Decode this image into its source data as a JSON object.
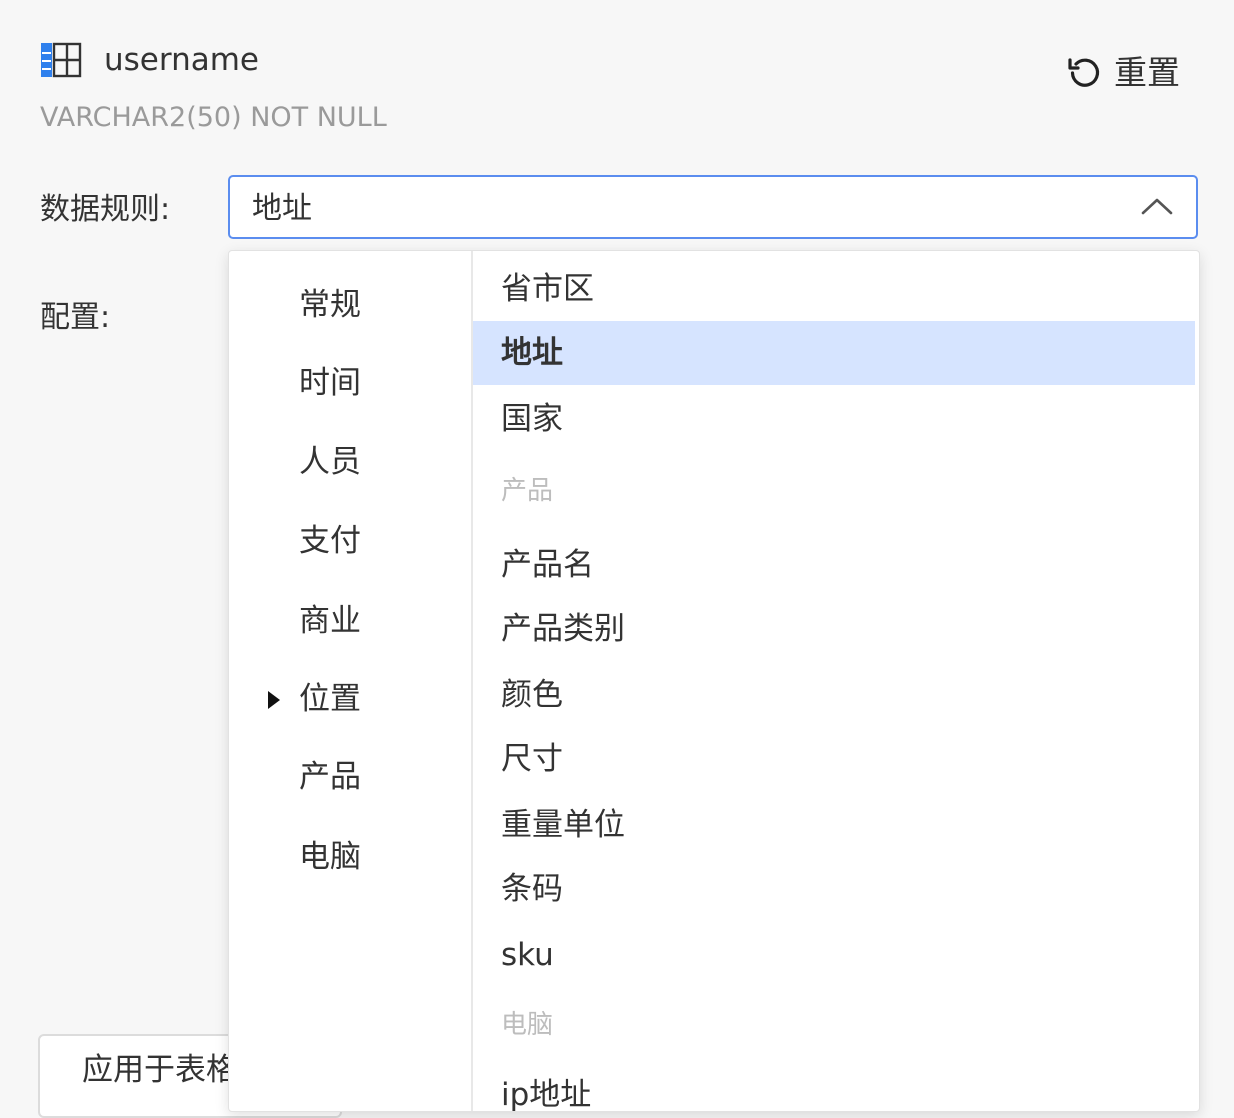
{
  "field": {
    "icon": "table-column-icon",
    "name": "username",
    "type": "VARCHAR2(50) NOT NULL"
  },
  "reset": {
    "icon": "reset-icon",
    "label": "重置"
  },
  "rule": {
    "label": "数据规则:",
    "value": "地址",
    "chevron_icon": "chevron-up-icon"
  },
  "config": {
    "label": "配置:"
  },
  "dropdown": {
    "categories": [
      {
        "label": "常规"
      },
      {
        "label": "时间"
      },
      {
        "label": "人员"
      },
      {
        "label": "支付"
      },
      {
        "label": "商业"
      },
      {
        "label": "位置",
        "active": true,
        "icon": "caret-right-icon"
      },
      {
        "label": "产品"
      },
      {
        "label": "电脑"
      }
    ],
    "options": [
      {
        "label": "省市区"
      },
      {
        "label": "地址",
        "selected": true
      },
      {
        "label": "国家"
      }
    ],
    "group_product": "产品",
    "product_options": [
      {
        "label": "产品名"
      },
      {
        "label": "产品类别"
      },
      {
        "label": "颜色"
      },
      {
        "label": "尺寸"
      },
      {
        "label": "重量单位"
      },
      {
        "label": "条码"
      },
      {
        "label": "sku"
      }
    ],
    "group_computer": "电脑",
    "computer_options": [
      {
        "label": "ip地址"
      }
    ]
  },
  "footer": {
    "apply_label": "应用于表格"
  },
  "colors": {
    "accent": "#5b8def",
    "selected_bg": "#d6e4ff",
    "muted_text": "#9a9a9a",
    "group_header": "#bdbdbd"
  }
}
